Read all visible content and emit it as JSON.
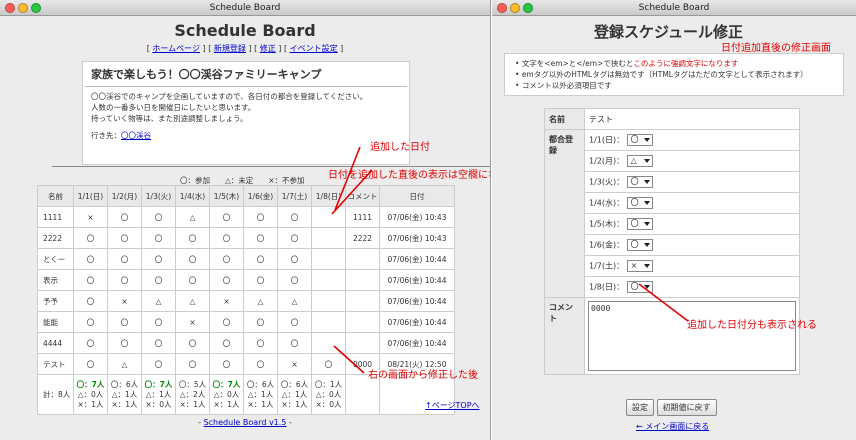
{
  "left": {
    "title": "Schedule Board",
    "header": "Schedule Board",
    "nav": [
      "ホームページ",
      "新規登録",
      "修正",
      "イベント設定"
    ],
    "event": {
      "title": "家族で楽しもう！〇〇渓谷ファミリーキャンプ",
      "lines": [
        "〇〇渓谷でのキャンプを企画していますので、各日付の都合を登録してください。",
        "人数の一番多い日を開催日にしたいと思います。",
        "持っていく物等は、また別途調整しましょう。"
      ],
      "dest_label": "行き先：",
      "dest_link": "〇〇渓谷"
    },
    "legend": "〇：参加　　△：未定　　×：不参加",
    "columns": [
      "名前",
      "1/1(日)",
      "1/2(月)",
      "1/3(火)",
      "1/4(水)",
      "1/5(木)",
      "1/6(金)",
      "1/7(土)",
      "1/8(日)",
      "コメント",
      "日付"
    ],
    "rows": [
      [
        "1111",
        "×",
        "〇",
        "〇",
        "△",
        "〇",
        "〇",
        "〇",
        "",
        "1111",
        "07/06(金) 10:43"
      ],
      [
        "2222",
        "〇",
        "〇",
        "〇",
        "〇",
        "〇",
        "〇",
        "〇",
        "",
        "2222",
        "07/06(金) 10:43"
      ],
      [
        "とくー",
        "〇",
        "〇",
        "〇",
        "〇",
        "〇",
        "〇",
        "〇",
        "",
        "",
        "07/06(金) 10:44"
      ],
      [
        "表示",
        "〇",
        "〇",
        "〇",
        "〇",
        "〇",
        "〇",
        "〇",
        "",
        "",
        "07/06(金) 10:44"
      ],
      [
        "予予",
        "〇",
        "×",
        "△",
        "△",
        "×",
        "△",
        "△",
        "",
        "",
        "07/06(金) 10:44"
      ],
      [
        "能能",
        "〇",
        "〇",
        "〇",
        "×",
        "〇",
        "〇",
        "〇",
        "",
        "",
        "07/06(金) 10:44"
      ],
      [
        "4444",
        "〇",
        "〇",
        "〇",
        "〇",
        "〇",
        "〇",
        "〇",
        "",
        "",
        "07/06(金) 10:44"
      ],
      [
        "テスト",
        "〇",
        "△",
        "〇",
        "〇",
        "〇",
        "〇",
        "×",
        "〇",
        "0000",
        "08/21(火) 12:50"
      ]
    ],
    "total_label": "計：8人",
    "totals": [
      [
        "〇：7人",
        "△：0人",
        "×：1人"
      ],
      [
        "〇：6人",
        "△：1人",
        "×：1人"
      ],
      [
        "〇：7人",
        "△：1人",
        "×：0人"
      ],
      [
        "〇：5人",
        "△：2人",
        "×：1人"
      ],
      [
        "〇：7人",
        "△：0人",
        "×：1人"
      ],
      [
        "〇：6人",
        "△：1人",
        "×：1人"
      ],
      [
        "〇：6人",
        "△：1人",
        "×：1人"
      ],
      [
        "〇：1人",
        "△：0人",
        "×：0人"
      ]
    ],
    "top_link": "↑ページTOPへ",
    "footer_prefix": "- ",
    "footer_link": "Schedule Board v1.5",
    "footer_suffix": " -",
    "notes": {
      "added_date": "追加した日付",
      "blank": "日付を追加した直後の表示は空欄になる",
      "after_fix": "右の画面から修正した後"
    }
  },
  "right": {
    "title": "Schedule Board",
    "header": "登録スケジュール修正",
    "subnote": "日付追加直後の修正画面",
    "bullets": [
      {
        "before": "文字を<em>と</em>で挟むと",
        "red": "このように強調文字になります"
      },
      {
        "before": "emタグ以外のHTMLタグは無効です（HTMLタグはただの文字として表示されます）",
        "red": ""
      },
      {
        "before": "コメント以外必須項目です",
        "red": ""
      }
    ],
    "name_label": "名前",
    "name_value": "テスト",
    "reg_label": "都合登録",
    "dates": [
      {
        "label": "1/1(日)：",
        "value": "〇"
      },
      {
        "label": "1/2(月)：",
        "value": "△"
      },
      {
        "label": "1/3(火)：",
        "value": "〇"
      },
      {
        "label": "1/4(水)：",
        "value": "〇"
      },
      {
        "label": "1/5(木)：",
        "value": "〇"
      },
      {
        "label": "1/6(金)：",
        "value": "〇"
      },
      {
        "label": "1/7(土)：",
        "value": "×"
      },
      {
        "label": "1/8(日)：",
        "value": "〇"
      }
    ],
    "comment_label": "コメント",
    "comment_value": "0000",
    "btn_submit": "設定",
    "btn_reset": "初期値に戻す",
    "back_link": "← メイン画面に戻る",
    "note_added": "追加した日付分も表示される"
  },
  "colors": {
    "note": "#e00000",
    "green": "#008800",
    "link": "#0000cc"
  }
}
